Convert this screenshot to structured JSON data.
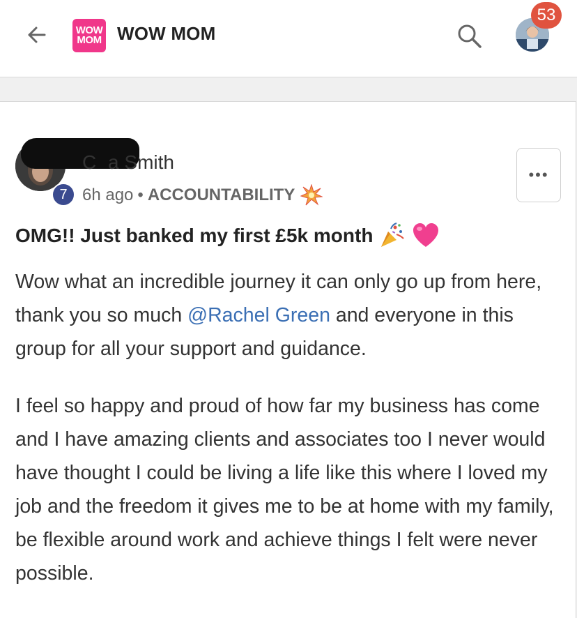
{
  "header": {
    "logo_line1": "WOW",
    "logo_line2": "MOM",
    "title": "WOW MOM",
    "notification_count": "53"
  },
  "post": {
    "author_name": "C   a Smith",
    "level": "7",
    "time": "6h ago",
    "separator": "•",
    "category": "ACCOUNTABILITY",
    "more_label": "•••",
    "title": "OMG!! Just banked my first £5k month",
    "para1_before": "Wow what an incredible journey it can only go up from here, thank you so much ",
    "mention": "@Rachel Green",
    "para1_after": " and everyone in this group for all your support and guidance.",
    "para2": "I feel so happy and proud of how far my business has come and I have amazing clients and associates too I never would have thought I could be living a life like this where I loved my job and the freedom it gives me to be at home with my family, be flexible around work and achieve things I felt were never possible."
  },
  "colors": {
    "brand_pink": "#f0378a",
    "badge_red": "#e0533f",
    "level_blue": "#3a4a8f",
    "mention_blue": "#3b6fb4"
  },
  "icons": {
    "back": "arrow-left-icon",
    "search": "search-icon",
    "category": "sparkle-burst-icon",
    "title_emojis": [
      "party-popper-icon",
      "pink-heart-icon"
    ]
  }
}
